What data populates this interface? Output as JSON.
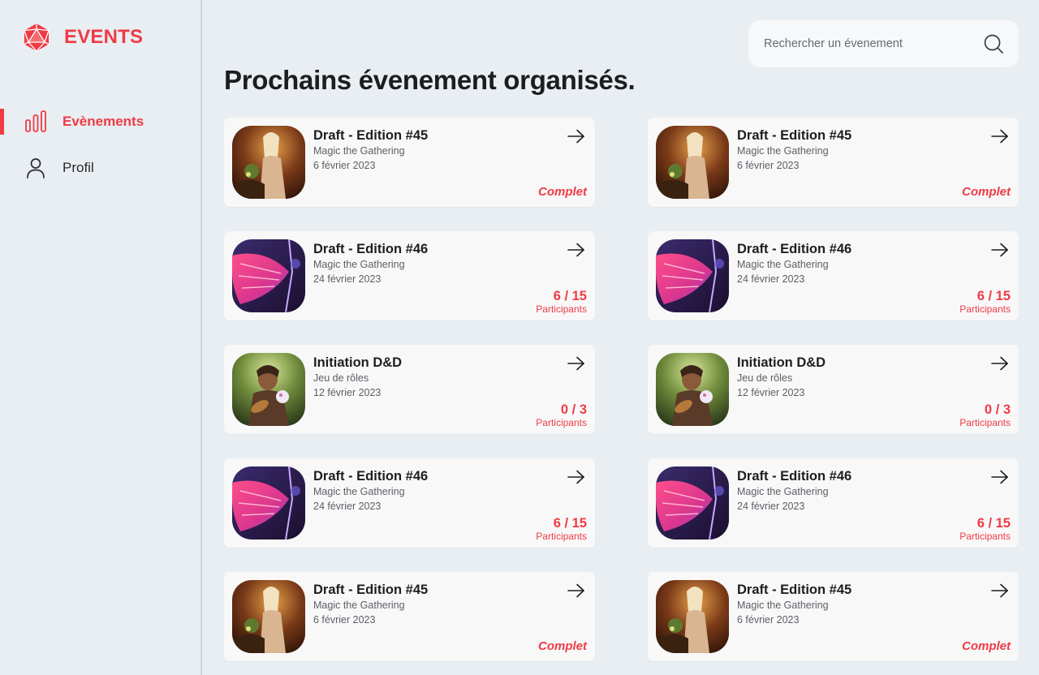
{
  "brand": {
    "title": "EVENTS",
    "accent": "#ef3b45"
  },
  "nav": {
    "items": [
      {
        "label": "Evènements",
        "icon": "bar-chart-icon",
        "active": true
      },
      {
        "label": "Profil",
        "icon": "user-icon",
        "active": false
      }
    ]
  },
  "search": {
    "placeholder": "Rechercher un évenement",
    "icon": "search-icon"
  },
  "page": {
    "title": "Prochains évenement organisés."
  },
  "events": [
    {
      "title": "Draft - Edition #45",
      "game": "Magic the Gathering",
      "date": "6 février 2023",
      "status": "Complet",
      "art": "warrior"
    },
    {
      "title": "Draft - Edition #45",
      "game": "Magic the Gathering",
      "date": "6 février 2023",
      "status": "Complet",
      "art": "warrior"
    },
    {
      "title": "Draft - Edition #46",
      "game": "Magic the Gathering",
      "date": "24 février 2023",
      "count": "6 / 15",
      "count_label": "Participants",
      "art": "wing"
    },
    {
      "title": "Draft - Edition #46",
      "game": "Magic the Gathering",
      "date": "24 février 2023",
      "count": "6 / 15",
      "count_label": "Participants",
      "art": "wing"
    },
    {
      "title": "Initiation D&D",
      "game": "Jeu de rôles",
      "date": "12 février 2023",
      "count": "0 / 3",
      "count_label": "Participants",
      "art": "bard"
    },
    {
      "title": "Initiation D&D",
      "game": "Jeu de rôles",
      "date": "12 février 2023",
      "count": "0 / 3",
      "count_label": "Participants",
      "art": "bard"
    },
    {
      "title": "Draft - Edition #46",
      "game": "Magic the Gathering",
      "date": "24 février 2023",
      "count": "6 / 15",
      "count_label": "Participants",
      "art": "wing"
    },
    {
      "title": "Draft - Edition #46",
      "game": "Magic the Gathering",
      "date": "24 février 2023",
      "count": "6 / 15",
      "count_label": "Participants",
      "art": "wing"
    },
    {
      "title": "Draft - Edition #45",
      "game": "Magic the Gathering",
      "date": "6 février 2023",
      "status": "Complet",
      "art": "warrior"
    },
    {
      "title": "Draft - Edition #45",
      "game": "Magic the Gathering",
      "date": "6 février 2023",
      "status": "Complet",
      "art": "warrior"
    }
  ]
}
